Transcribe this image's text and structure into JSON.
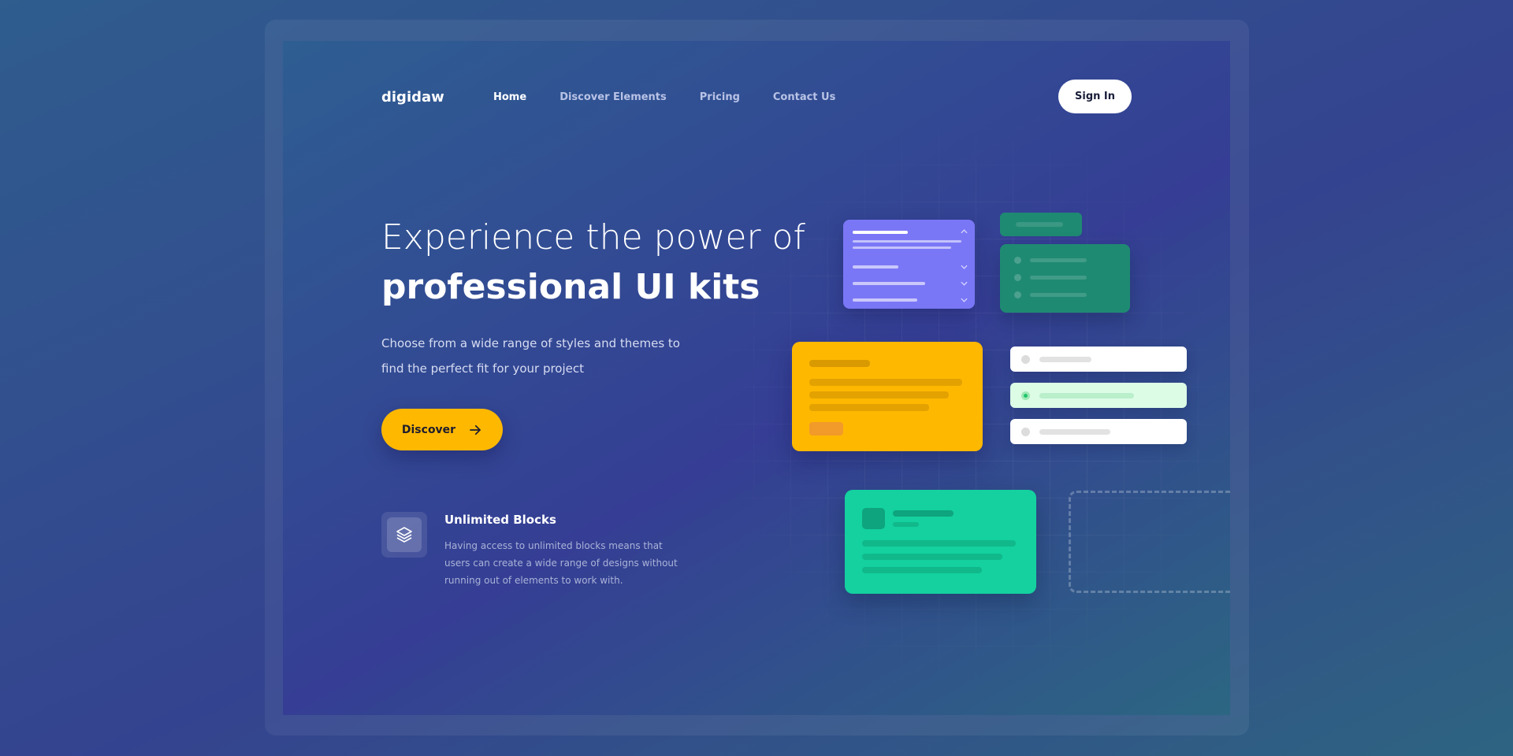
{
  "brand": {
    "logo": "digidaw"
  },
  "nav": {
    "items": [
      {
        "label": "Home",
        "active": true
      },
      {
        "label": "Discover Elements",
        "active": false
      },
      {
        "label": "Pricing",
        "active": false
      },
      {
        "label": "Contact Us",
        "active": false
      }
    ],
    "signin_label": "Sign In"
  },
  "hero": {
    "title_light": "Experience the power of",
    "title_bold": "professional UI kits",
    "description": "Choose from a wide range of styles and themes to find the perfect fit for your project",
    "cta_label": "Discover",
    "cta_icon": "arrow-right-icon"
  },
  "feature": {
    "icon": "layers-icon",
    "title": "Unlimited Blocks",
    "description": "Having access to unlimited blocks means that users can create a wide range of designs without running out of elements to work with."
  },
  "colors": {
    "accent": "#ffb800",
    "purple_card": "#7a77f6",
    "teal_card": "#1f8a72",
    "green_card": "#14d19f",
    "white": "#ffffff"
  }
}
